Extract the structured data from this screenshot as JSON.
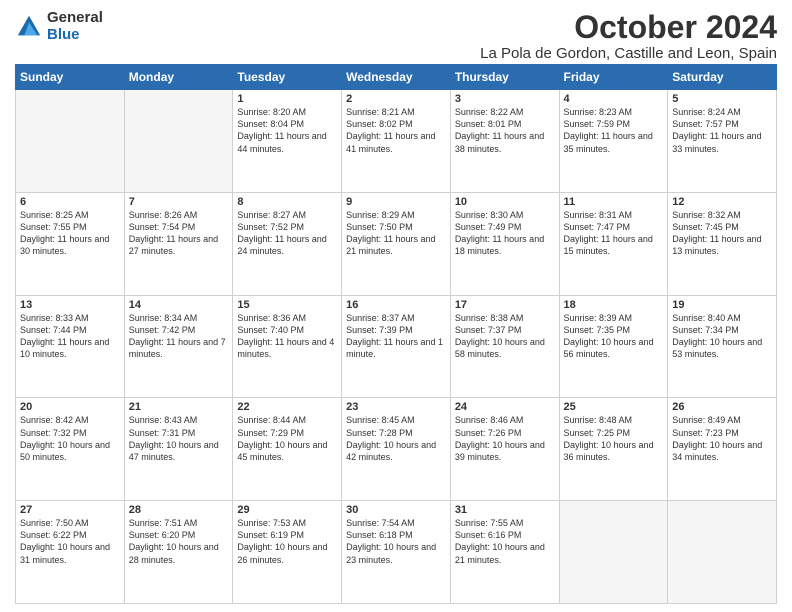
{
  "logo": {
    "general": "General",
    "blue": "Blue"
  },
  "title": "October 2024",
  "location": "La Pola de Gordon, Castille and Leon, Spain",
  "days_of_week": [
    "Sunday",
    "Monday",
    "Tuesday",
    "Wednesday",
    "Thursday",
    "Friday",
    "Saturday"
  ],
  "weeks": [
    [
      {
        "day": null
      },
      {
        "day": null
      },
      {
        "day": "1",
        "sunrise": "Sunrise: 8:20 AM",
        "sunset": "Sunset: 8:04 PM",
        "daylight": "Daylight: 11 hours and 44 minutes."
      },
      {
        "day": "2",
        "sunrise": "Sunrise: 8:21 AM",
        "sunset": "Sunset: 8:02 PM",
        "daylight": "Daylight: 11 hours and 41 minutes."
      },
      {
        "day": "3",
        "sunrise": "Sunrise: 8:22 AM",
        "sunset": "Sunset: 8:01 PM",
        "daylight": "Daylight: 11 hours and 38 minutes."
      },
      {
        "day": "4",
        "sunrise": "Sunrise: 8:23 AM",
        "sunset": "Sunset: 7:59 PM",
        "daylight": "Daylight: 11 hours and 35 minutes."
      },
      {
        "day": "5",
        "sunrise": "Sunrise: 8:24 AM",
        "sunset": "Sunset: 7:57 PM",
        "daylight": "Daylight: 11 hours and 33 minutes."
      }
    ],
    [
      {
        "day": "6",
        "sunrise": "Sunrise: 8:25 AM",
        "sunset": "Sunset: 7:55 PM",
        "daylight": "Daylight: 11 hours and 30 minutes."
      },
      {
        "day": "7",
        "sunrise": "Sunrise: 8:26 AM",
        "sunset": "Sunset: 7:54 PM",
        "daylight": "Daylight: 11 hours and 27 minutes."
      },
      {
        "day": "8",
        "sunrise": "Sunrise: 8:27 AM",
        "sunset": "Sunset: 7:52 PM",
        "daylight": "Daylight: 11 hours and 24 minutes."
      },
      {
        "day": "9",
        "sunrise": "Sunrise: 8:29 AM",
        "sunset": "Sunset: 7:50 PM",
        "daylight": "Daylight: 11 hours and 21 minutes."
      },
      {
        "day": "10",
        "sunrise": "Sunrise: 8:30 AM",
        "sunset": "Sunset: 7:49 PM",
        "daylight": "Daylight: 11 hours and 18 minutes."
      },
      {
        "day": "11",
        "sunrise": "Sunrise: 8:31 AM",
        "sunset": "Sunset: 7:47 PM",
        "daylight": "Daylight: 11 hours and 15 minutes."
      },
      {
        "day": "12",
        "sunrise": "Sunrise: 8:32 AM",
        "sunset": "Sunset: 7:45 PM",
        "daylight": "Daylight: 11 hours and 13 minutes."
      }
    ],
    [
      {
        "day": "13",
        "sunrise": "Sunrise: 8:33 AM",
        "sunset": "Sunset: 7:44 PM",
        "daylight": "Daylight: 11 hours and 10 minutes."
      },
      {
        "day": "14",
        "sunrise": "Sunrise: 8:34 AM",
        "sunset": "Sunset: 7:42 PM",
        "daylight": "Daylight: 11 hours and 7 minutes."
      },
      {
        "day": "15",
        "sunrise": "Sunrise: 8:36 AM",
        "sunset": "Sunset: 7:40 PM",
        "daylight": "Daylight: 11 hours and 4 minutes."
      },
      {
        "day": "16",
        "sunrise": "Sunrise: 8:37 AM",
        "sunset": "Sunset: 7:39 PM",
        "daylight": "Daylight: 11 hours and 1 minute."
      },
      {
        "day": "17",
        "sunrise": "Sunrise: 8:38 AM",
        "sunset": "Sunset: 7:37 PM",
        "daylight": "Daylight: 10 hours and 58 minutes."
      },
      {
        "day": "18",
        "sunrise": "Sunrise: 8:39 AM",
        "sunset": "Sunset: 7:35 PM",
        "daylight": "Daylight: 10 hours and 56 minutes."
      },
      {
        "day": "19",
        "sunrise": "Sunrise: 8:40 AM",
        "sunset": "Sunset: 7:34 PM",
        "daylight": "Daylight: 10 hours and 53 minutes."
      }
    ],
    [
      {
        "day": "20",
        "sunrise": "Sunrise: 8:42 AM",
        "sunset": "Sunset: 7:32 PM",
        "daylight": "Daylight: 10 hours and 50 minutes."
      },
      {
        "day": "21",
        "sunrise": "Sunrise: 8:43 AM",
        "sunset": "Sunset: 7:31 PM",
        "daylight": "Daylight: 10 hours and 47 minutes."
      },
      {
        "day": "22",
        "sunrise": "Sunrise: 8:44 AM",
        "sunset": "Sunset: 7:29 PM",
        "daylight": "Daylight: 10 hours and 45 minutes."
      },
      {
        "day": "23",
        "sunrise": "Sunrise: 8:45 AM",
        "sunset": "Sunset: 7:28 PM",
        "daylight": "Daylight: 10 hours and 42 minutes."
      },
      {
        "day": "24",
        "sunrise": "Sunrise: 8:46 AM",
        "sunset": "Sunset: 7:26 PM",
        "daylight": "Daylight: 10 hours and 39 minutes."
      },
      {
        "day": "25",
        "sunrise": "Sunrise: 8:48 AM",
        "sunset": "Sunset: 7:25 PM",
        "daylight": "Daylight: 10 hours and 36 minutes."
      },
      {
        "day": "26",
        "sunrise": "Sunrise: 8:49 AM",
        "sunset": "Sunset: 7:23 PM",
        "daylight": "Daylight: 10 hours and 34 minutes."
      }
    ],
    [
      {
        "day": "27",
        "sunrise": "Sunrise: 7:50 AM",
        "sunset": "Sunset: 6:22 PM",
        "daylight": "Daylight: 10 hours and 31 minutes."
      },
      {
        "day": "28",
        "sunrise": "Sunrise: 7:51 AM",
        "sunset": "Sunset: 6:20 PM",
        "daylight": "Daylight: 10 hours and 28 minutes."
      },
      {
        "day": "29",
        "sunrise": "Sunrise: 7:53 AM",
        "sunset": "Sunset: 6:19 PM",
        "daylight": "Daylight: 10 hours and 26 minutes."
      },
      {
        "day": "30",
        "sunrise": "Sunrise: 7:54 AM",
        "sunset": "Sunset: 6:18 PM",
        "daylight": "Daylight: 10 hours and 23 minutes."
      },
      {
        "day": "31",
        "sunrise": "Sunrise: 7:55 AM",
        "sunset": "Sunset: 6:16 PM",
        "daylight": "Daylight: 10 hours and 21 minutes."
      },
      {
        "day": null
      },
      {
        "day": null
      }
    ]
  ]
}
